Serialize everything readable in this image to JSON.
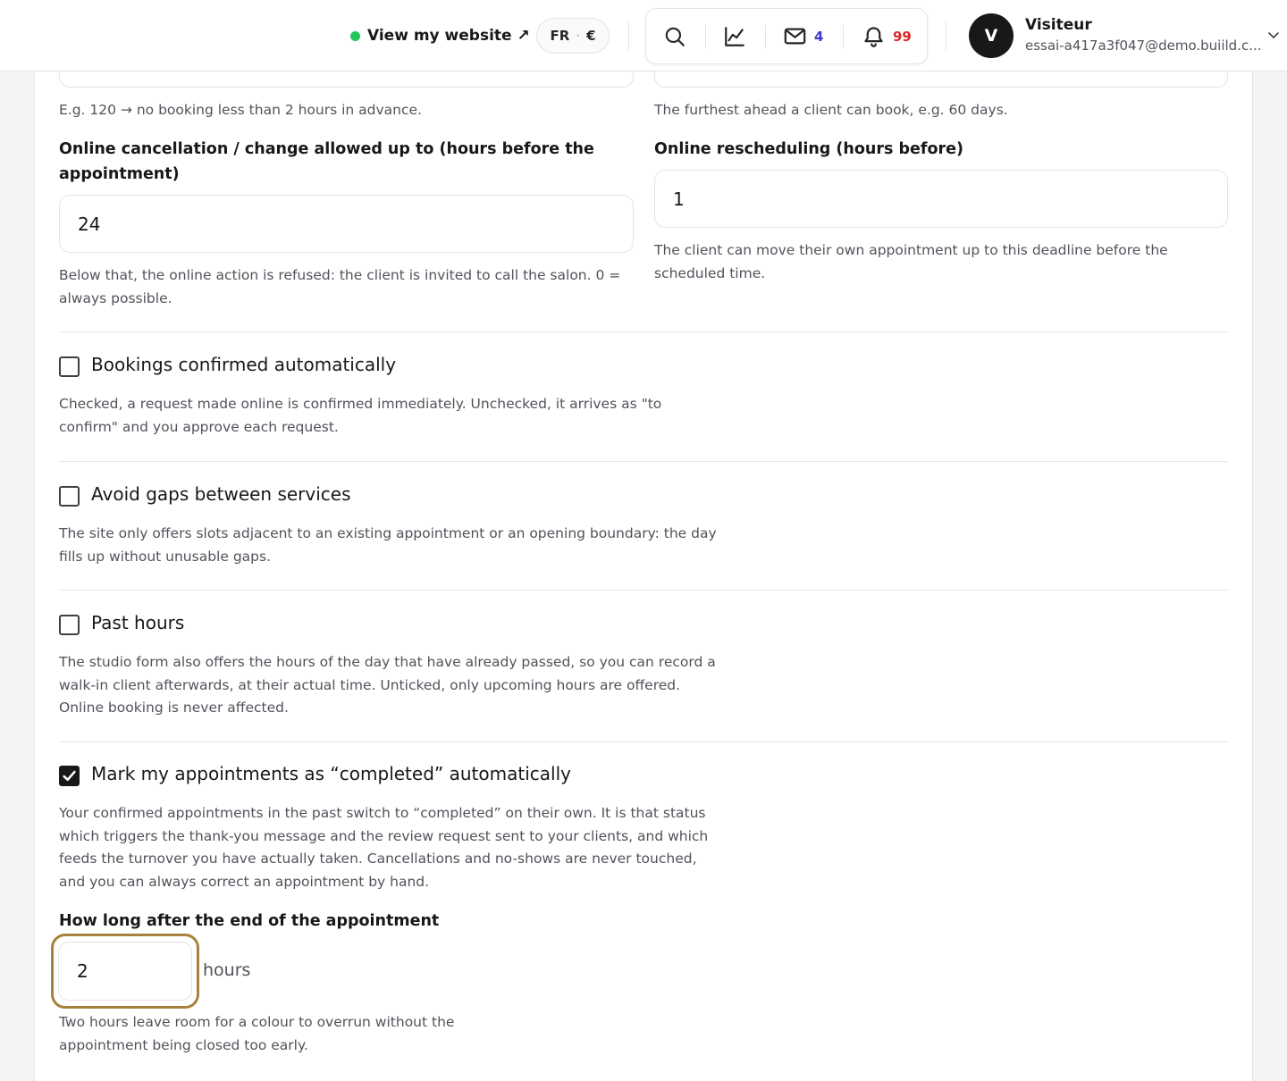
{
  "header": {
    "view_site_label": "View my website ↗",
    "locale": {
      "language": "FR",
      "separator": "·",
      "currency": "€"
    },
    "tools": {
      "search_icon": "search-icon",
      "stats_icon": "chart-line-icon",
      "mail_icon": "mail-icon",
      "mail_count": "4",
      "bell_icon": "bell-icon",
      "notification_count": "99"
    },
    "user": {
      "initial": "V",
      "name": "Visiteur",
      "email": "essai-a417a3f047@demo.buiild.c..."
    },
    "colors": {
      "online_dot": "#22c55e",
      "mail_count": "#4338ca",
      "notification_count": "#dc2626",
      "focus_ring": "#a6823e"
    }
  },
  "settings": {
    "min_notice_help": "E.g. 120 → no booking less than 2 hours in advance.",
    "max_advance_help": "The furthest ahead a client can book, e.g. 60 days.",
    "cancellation": {
      "label": "Online cancellation / change allowed up to (hours before the appointment)",
      "value": "24",
      "help": "Below that, the online action is refused: the client is invited to call the salon. 0 = always possible."
    },
    "rescheduling": {
      "label": "Online rescheduling (hours before)",
      "value": "1",
      "help": "The client can move their own appointment up to this deadline before the scheduled time."
    },
    "auto_confirm": {
      "label": "Bookings confirmed automatically",
      "checked": false,
      "help": "Checked, a request made online is confirmed immediately. Unchecked, it arrives as \"to confirm\" and you approve each request."
    },
    "avoid_gaps": {
      "label": "Avoid gaps between services",
      "checked": false,
      "help": "The site only offers slots adjacent to an existing appointment or an opening boundary: the day fills up without unusable gaps."
    },
    "past_hours": {
      "label": "Past hours",
      "checked": false,
      "help": "The studio form also offers the hours of the day that have already passed, so you can record a walk-in client afterwards, at their actual time. Unticked, only upcoming hours are offered. Online booking is never affected."
    },
    "auto_complete": {
      "label": "Mark my appointments as “completed” automatically",
      "checked": true,
      "help": "Your confirmed appointments in the past switch to “completed” on their own. It is that status which triggers the thank-you message and the review request sent to your clients, and which feeds the turnover you have actually taken. Cancellations and no-shows are never touched, and you can always correct an appointment by hand."
    },
    "delay": {
      "label": "How long after the end of the appointment",
      "value": "2",
      "unit": "hours",
      "help": "Two hours leave room for a colour to overrun without the appointment being closed too early."
    }
  }
}
